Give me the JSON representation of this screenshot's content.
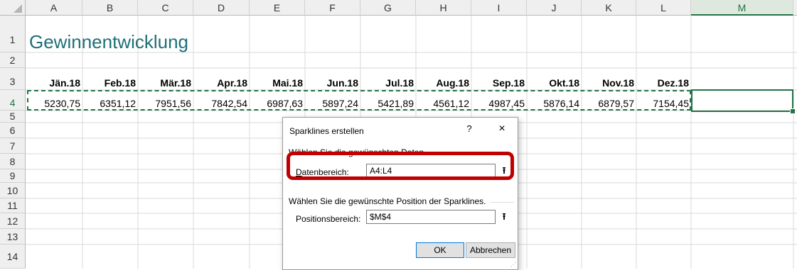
{
  "columns": [
    "A",
    "B",
    "C",
    "D",
    "E",
    "F",
    "G",
    "H",
    "I",
    "J",
    "K",
    "L",
    "M"
  ],
  "rows": [
    "1",
    "2",
    "3",
    "4",
    "5",
    "6",
    "7",
    "8",
    "9",
    "10",
    "11",
    "12",
    "13",
    "14"
  ],
  "sheet": {
    "title": "Gewinnentwicklung",
    "months": [
      "Jän.18",
      "Feb.18",
      "Mär.18",
      "Apr.18",
      "Mai.18",
      "Jun.18",
      "Jul.18",
      "Aug.18",
      "Sep.18",
      "Okt.18",
      "Nov.18",
      "Dez.18"
    ],
    "values": [
      "5230,75",
      "6351,12",
      "7951,56",
      "7842,54",
      "6987,63",
      "5897,24",
      "5421,89",
      "4561,12",
      "4987,45",
      "5876,14",
      "6879,57",
      "7154,45"
    ]
  },
  "dialog": {
    "title": "Sparklines erstellen",
    "help": "?",
    "close": "×",
    "section_data": "Wählen Sie die gewünschten Daten",
    "data_range_label": "Datenbereich:",
    "data_range_value": "A4:L4",
    "section_position": "Wählen Sie die gewünschte Position der Sparklines.",
    "position_range_label": "Positionsbereich:",
    "position_range_value": "$M$4",
    "ok": "OK",
    "cancel": "Abbrechen"
  },
  "colors": {
    "accent": "#217346",
    "title": "#1f6f79",
    "highlight": "#c00000"
  }
}
